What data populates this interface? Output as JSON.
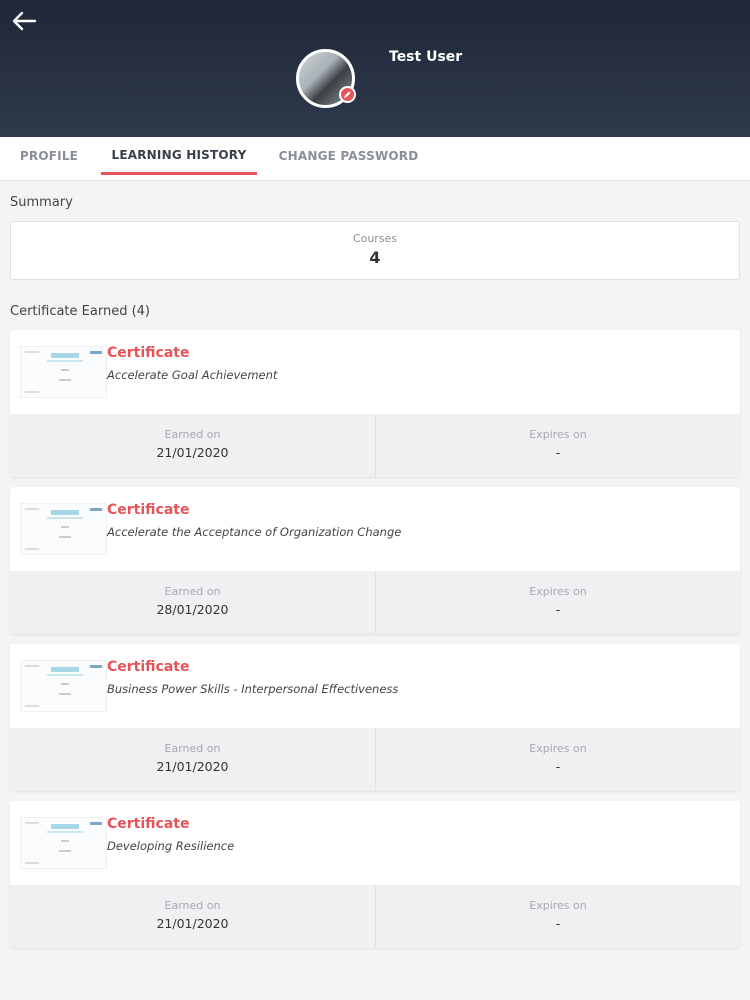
{
  "header": {
    "user_name": "Test User",
    "back_icon": "arrow-left-icon",
    "edit_icon": "edit-badge-icon"
  },
  "tabs": [
    {
      "label": "PROFILE",
      "active": false
    },
    {
      "label": "LEARNING HISTORY",
      "active": true
    },
    {
      "label": "CHANGE PASSWORD",
      "active": false
    }
  ],
  "summary": {
    "heading": "Summary",
    "courses_label": "Courses",
    "courses_value": "4"
  },
  "certificates": {
    "heading": "Certificate Earned (4)",
    "items": [
      {
        "title": "Certificate",
        "course": "Accelerate Goal Achievement",
        "earned_label": "Earned on",
        "earned_value": "21/01/2020",
        "expires_label": "Expires on",
        "expires_value": "-"
      },
      {
        "title": "Certificate",
        "course": "Accelerate the Acceptance of Organization Change",
        "earned_label": "Earned on",
        "earned_value": "28/01/2020",
        "expires_label": "Expires on",
        "expires_value": "-"
      },
      {
        "title": "Certificate",
        "course": "Business Power Skills - Interpersonal Effectiveness",
        "earned_label": "Earned on",
        "earned_value": "21/01/2020",
        "expires_label": "Expires on",
        "expires_value": "-"
      },
      {
        "title": "Certificate",
        "course": "Developing Resilience",
        "earned_label": "Earned on",
        "earned_value": "21/01/2020",
        "expires_label": "Expires on",
        "expires_value": "-"
      }
    ]
  },
  "colors": {
    "accent": "#e6545a",
    "header_dark": "#1f2738"
  }
}
